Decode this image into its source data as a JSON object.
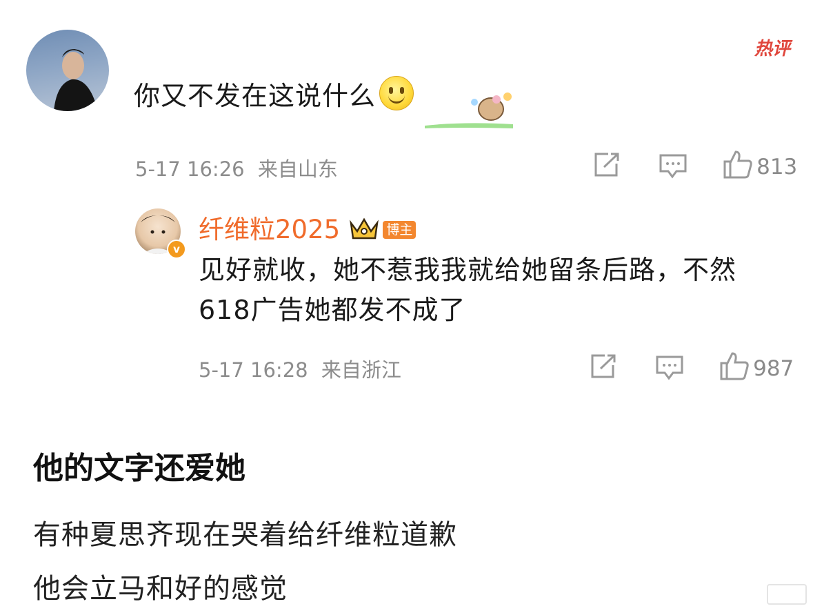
{
  "comment": {
    "text": "你又不发在这说什么",
    "emoji": "smiley-emoji",
    "timestamp": "5-17 16:26",
    "location": "来自山东",
    "like_count": "813",
    "badge": "热评"
  },
  "reply": {
    "username": "纤维粒2025",
    "tag": "博主",
    "text_line1": "见好就收，她不惹我我就给她留条后路，不然",
    "text_line2": "618广告她都发不成了",
    "timestamp": "5-17 16:28",
    "location": "来自浙江",
    "like_count": "987"
  },
  "post": {
    "title": "他的文字还爱她",
    "line1": "有种夏思齐现在哭着给纤维粒道歉",
    "line2": "他会立马和好的感觉"
  },
  "icons": {
    "share": "share-icon",
    "comment": "comment-icon",
    "like": "thumbs-up-icon",
    "crown": "crown-icon",
    "verified": "verified-badge-icon"
  },
  "colors": {
    "username": "#f06b2b",
    "hot_badge": "#e0463c",
    "blogger_tag": "#f3872f"
  }
}
